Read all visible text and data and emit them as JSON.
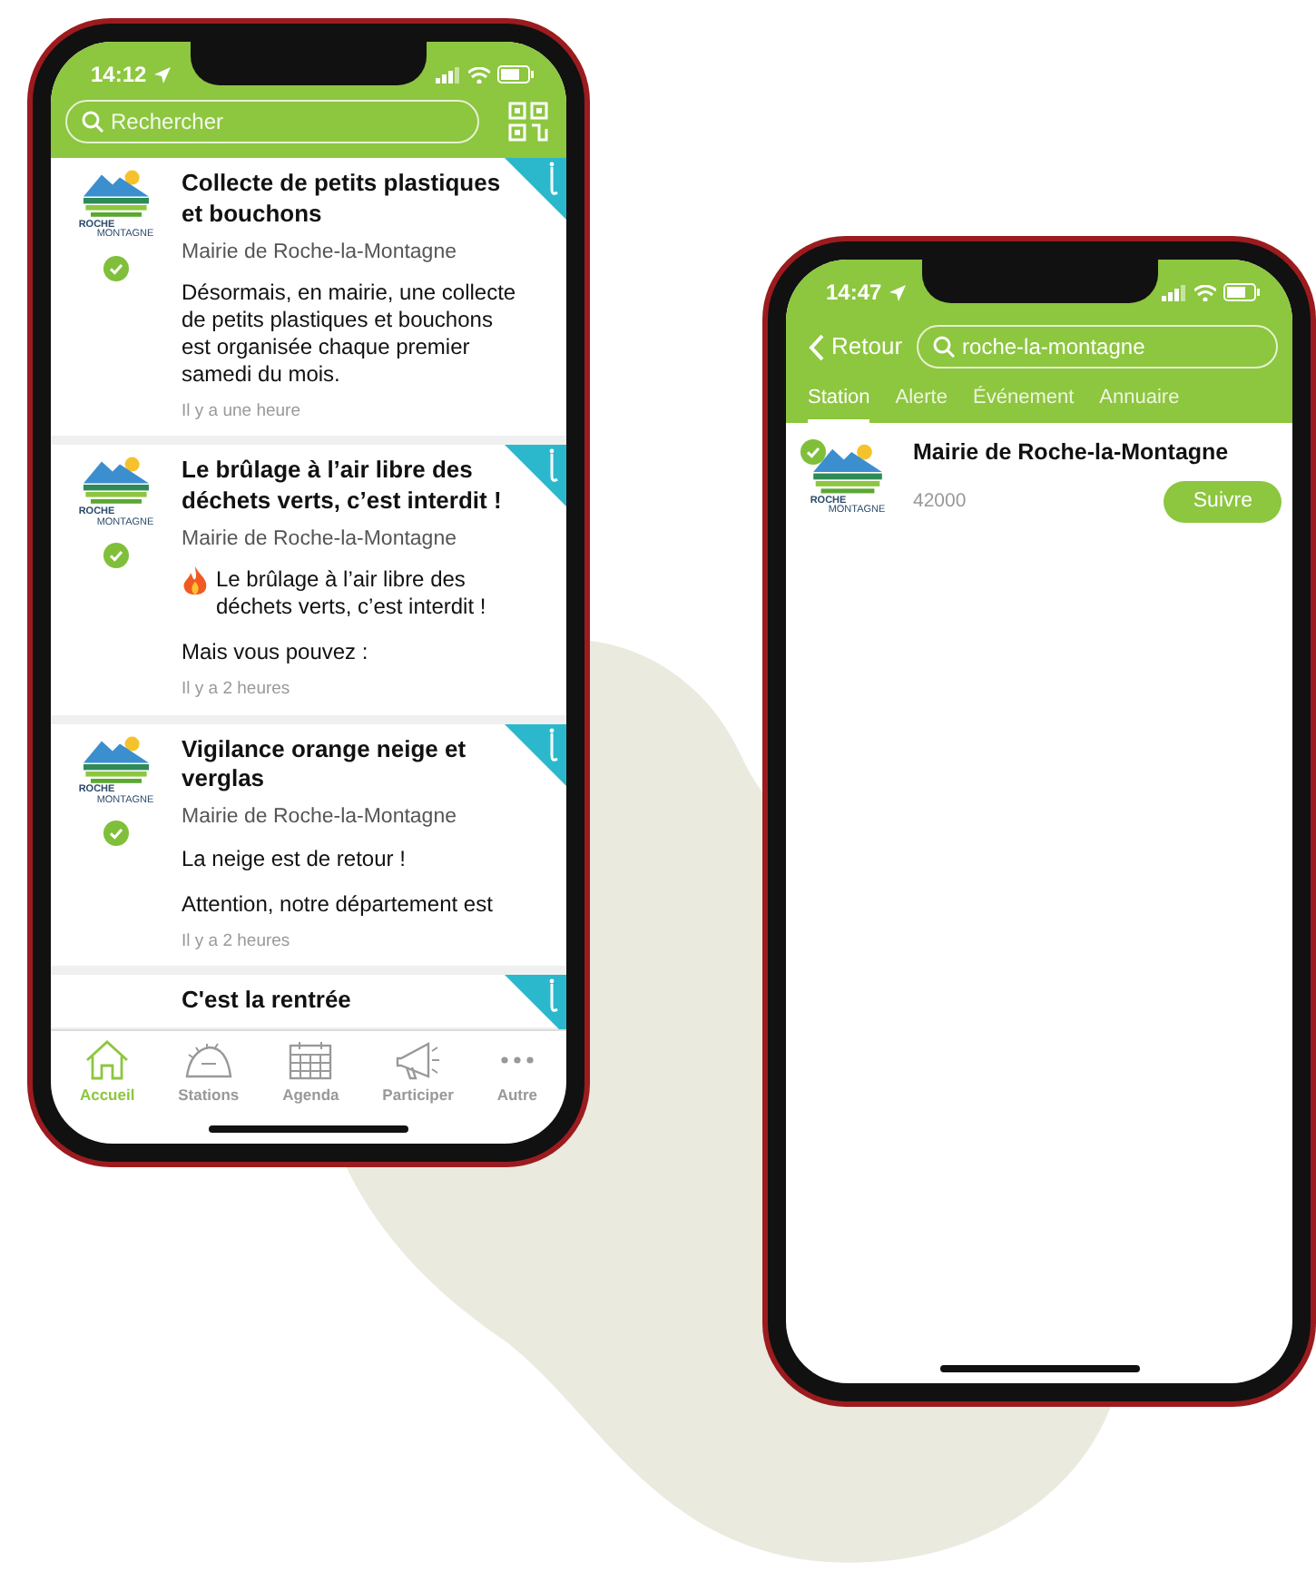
{
  "home_screen": {
    "status_time": "14:12",
    "search": {
      "placeholder": "Rechercher"
    },
    "posts": [
      {
        "title": "Collecte de petits plastiques et bouchons",
        "author": "Mairie de Roche-la-Montagne",
        "logo": {
          "top": "ROCHE",
          "bottom": "MONTAGNE"
        },
        "verified": true,
        "body": [
          {
            "text": "Désormais, en mairie, une collecte de petits plastiques et bouchons est organisée chaque premier samedi du mois.",
            "leading_icon": false
          }
        ],
        "time": "Il y a une heure"
      },
      {
        "title": "Le brûlage à l’air libre des déchets verts, c’est interdit !",
        "author": "Mairie de Roche-la-Montagne",
        "logo": {
          "top": "ROCHE",
          "bottom": "MONTAGNE"
        },
        "verified": true,
        "body": [
          {
            "text": "Le brûlage à l’air libre des déchets verts, c’est interdit !",
            "leading_icon": true
          },
          {
            "text": "Mais vous pouvez :",
            "leading_icon": false
          }
        ],
        "time": "Il y a 2 heures"
      },
      {
        "title": "Vigilance orange neige et verglas",
        "author": "Mairie de Roche-la-Montagne",
        "logo": {
          "top": "ROCHE",
          "bottom": "MONTAGNE"
        },
        "verified": true,
        "body": [
          {
            "text": "La neige est de retour !",
            "leading_icon": false
          },
          {
            "text": "Attention, notre département est",
            "leading_icon": false
          }
        ],
        "time": "Il y a 2 heures"
      },
      {
        "title": "C'est la rentrée"
      }
    ],
    "tab_bar": [
      {
        "label": "Accueil",
        "selected": true
      },
      {
        "label": "Stations",
        "selected": false
      },
      {
        "label": "Agenda",
        "selected": false
      },
      {
        "label": "Participer",
        "selected": false
      },
      {
        "label": "Autre",
        "selected": false
      }
    ]
  },
  "search_screen": {
    "status_time": "14:47",
    "back": "Retour",
    "search": {
      "value": "roche-la-montagne"
    },
    "tabs": [
      {
        "label": "Station",
        "selected": true
      },
      {
        "label": "Alerte",
        "selected": false
      },
      {
        "label": "Événement",
        "selected": false
      },
      {
        "label": "Annuaire",
        "selected": false
      }
    ],
    "results": [
      {
        "name": "Mairie de Roche-la-Montagne",
        "code": "42000",
        "logo": {
          "top": "ROCHE",
          "bottom": "MONTAGNE"
        },
        "verified": true,
        "follow_label": "Suivre"
      }
    ]
  }
}
